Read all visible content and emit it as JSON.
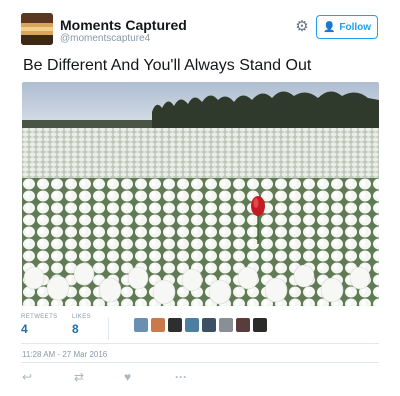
{
  "user": {
    "display_name": "Moments Captured",
    "handle": "@momentscapture4"
  },
  "header": {
    "gear_icon": "gear-icon",
    "follow_label": "Follow",
    "follow_icon": "add-user-icon"
  },
  "tweet": {
    "text": "Be Different And You'll Always Stand Out",
    "photo_icon": "tulip-field-photo"
  },
  "stats": {
    "retweets_label": "RETWEETS",
    "retweets_count": "4",
    "likes_label": "LIKES",
    "likes_count": "8"
  },
  "likers": {
    "count": 8,
    "colors": [
      "#6b8fb3",
      "#c97a4a",
      "#2e2e2e",
      "#4d7fa1",
      "#3d4f63",
      "#8a8f96",
      "#5b3c3c",
      "#2d2a2a"
    ]
  },
  "timestamp": "11:28 AM - 27 Mar 2016",
  "actions": {
    "reply_icon": "reply-icon",
    "retweet_icon": "retweet-icon",
    "like_icon": "heart-icon",
    "more_icon": "more-icon"
  },
  "colors": {
    "accent": "#1da1f2",
    "count_blue": "#1b6fa8",
    "muted": "#8899a6",
    "tulip_red": "#c21b22"
  }
}
